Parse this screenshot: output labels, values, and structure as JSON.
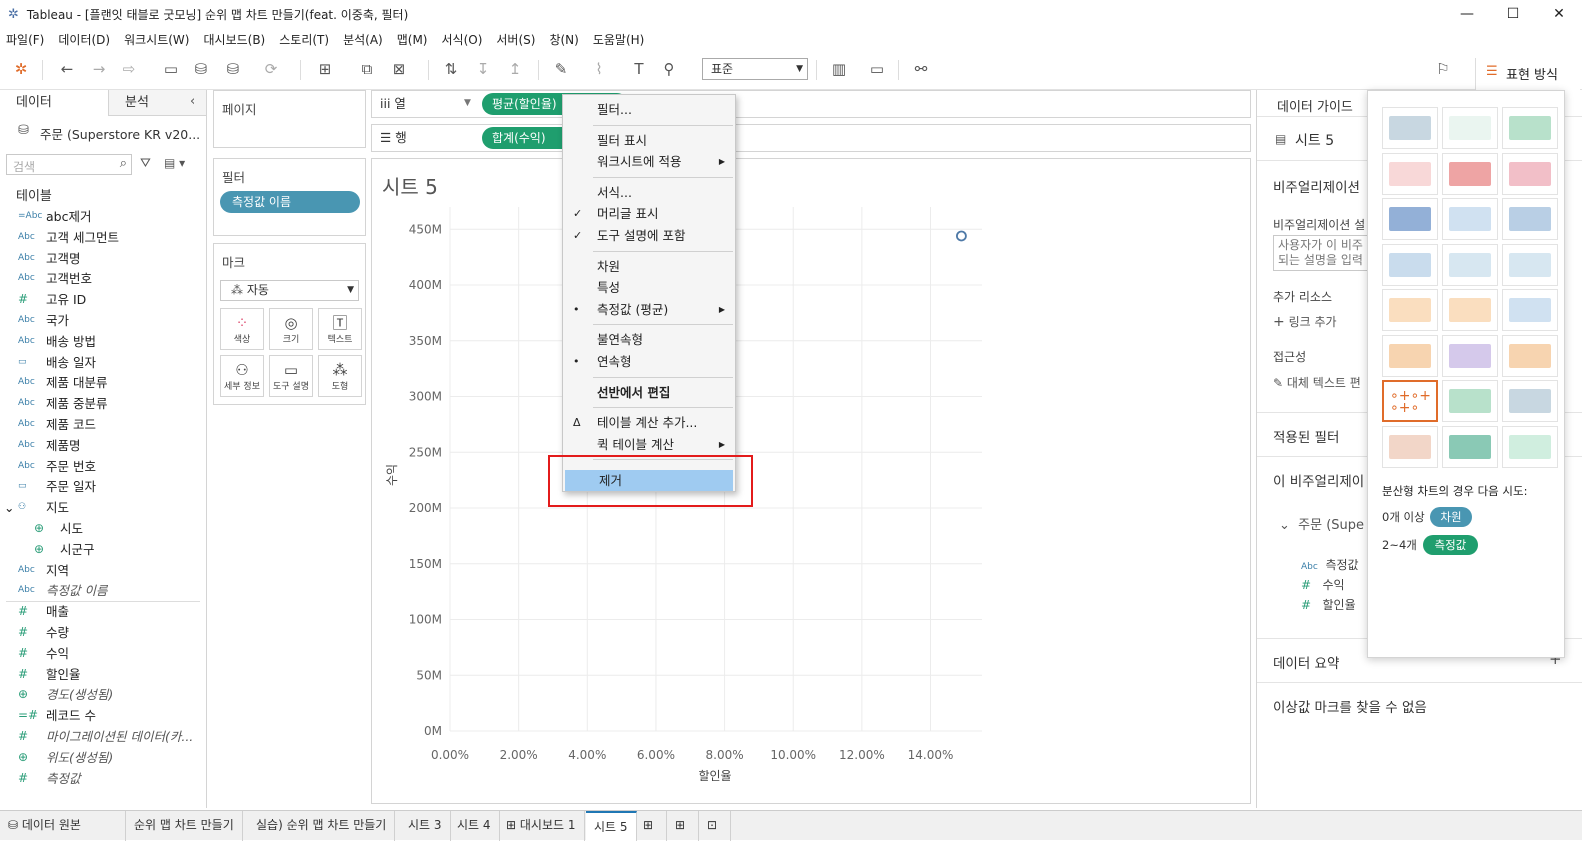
{
  "window": {
    "title": "Tableau - [플랜잇 태블로 굿모닝] 순위 맵 차트 만들기(feat. 이중축, 필터)"
  },
  "menu": [
    "파일(F)",
    "데이터(D)",
    "워크시트(W)",
    "대시보드(B)",
    "스토리(T)",
    "분석(A)",
    "맵(M)",
    "서식(O)",
    "서버(S)",
    "창(N)",
    "도움말(H)"
  ],
  "toolbar": {
    "fit_select": "표준",
    "show_me_label": "표현 방식"
  },
  "left": {
    "tab_data": "데이터",
    "tab_analysis": "분석",
    "datasource": "주문 (Superstore KR v20...",
    "search_placeholder": "검색",
    "tables_header": "테이블",
    "fields": [
      {
        "icon": "=Abc",
        "name": "abc제거"
      },
      {
        "icon": "Abc",
        "name": "고객 세그먼트"
      },
      {
        "icon": "Abc",
        "name": "고객명"
      },
      {
        "icon": "Abc",
        "name": "고객번호"
      },
      {
        "icon": "#",
        "name": "고유 ID"
      },
      {
        "icon": "Abc",
        "name": "국가"
      },
      {
        "icon": "Abc",
        "name": "배송 방법"
      },
      {
        "icon": "date",
        "name": "배송 일자"
      },
      {
        "icon": "Abc",
        "name": "제품 대분류"
      },
      {
        "icon": "Abc",
        "name": "제품 중분류"
      },
      {
        "icon": "Abc",
        "name": "제품 코드"
      },
      {
        "icon": "Abc",
        "name": "제품명"
      },
      {
        "icon": "Abc",
        "name": "주문 번호"
      },
      {
        "icon": "date",
        "name": "주문 일자"
      },
      {
        "icon": "hier",
        "name": "지도"
      },
      {
        "icon": "globe",
        "name": "시도"
      },
      {
        "icon": "globe",
        "name": "시군구"
      },
      {
        "icon": "Abc",
        "name": "지역"
      },
      {
        "icon": "Abc",
        "name": "측정값 이름"
      },
      {
        "icon": "#",
        "name": "매출"
      },
      {
        "icon": "#",
        "name": "수량"
      },
      {
        "icon": "#",
        "name": "수익"
      },
      {
        "icon": "#",
        "name": "할인율"
      },
      {
        "icon": "globe",
        "name": "경도(생성됨)"
      },
      {
        "icon": "=#",
        "name": "레코드 수"
      },
      {
        "icon": "#",
        "name": "마이그레이션된 데이터(카..."
      },
      {
        "icon": "globe",
        "name": "위도(생성됨)"
      },
      {
        "icon": "#",
        "name": "측정값"
      }
    ]
  },
  "cards": {
    "pages": "페이지",
    "filters": "필터",
    "filter_pill": "측정값 이름",
    "marks": "마크",
    "mark_type": "자동",
    "mark_buttons": [
      "색상",
      "크기",
      "텍스트",
      "세부 정보",
      "도구 설명",
      "도형"
    ]
  },
  "shelves": {
    "columns_label": "열",
    "rows_label": "행",
    "columns_pill": "평균(할인율)",
    "rows_pill": "합계(수익)"
  },
  "view": {
    "sheet_title": "시트 5"
  },
  "context_menu": {
    "items": [
      {
        "label": "필터...",
        "check": "",
        "sub": ""
      },
      {
        "label": "필터 표시",
        "check": "",
        "sub": ""
      },
      {
        "label": "워크시트에 적용",
        "check": "",
        "sub": "▶"
      },
      {
        "label": "서식...",
        "check": "",
        "sub": ""
      },
      {
        "label": "머리글 표시",
        "check": "✓",
        "sub": ""
      },
      {
        "label": "도구 설명에 포함",
        "check": "✓",
        "sub": ""
      },
      {
        "label": "차원",
        "check": "",
        "sub": ""
      },
      {
        "label": "특성",
        "check": "",
        "sub": ""
      },
      {
        "label": "측정값 (평균)",
        "check": "•",
        "sub": "▶"
      },
      {
        "label": "불연속형",
        "check": "",
        "sub": ""
      },
      {
        "label": "연속형",
        "check": "•",
        "sub": ""
      },
      {
        "label": "선반에서 편집",
        "check": "",
        "sub": ""
      },
      {
        "label": "테이블 계산 추가...",
        "check": "Δ",
        "sub": ""
      },
      {
        "label": "퀵 테이블 계산",
        "check": "",
        "sub": "▶"
      },
      {
        "label": "제거",
        "check": "",
        "sub": ""
      }
    ]
  },
  "chart_data": {
    "type": "scatter",
    "title": "",
    "xlabel": "할인율",
    "ylabel": "수익",
    "x_ticks": [
      "0.00%",
      "2.00%",
      "4.00%",
      "6.00%",
      "8.00%",
      "10.00%",
      "12.00%",
      "14.00%"
    ],
    "y_ticks": [
      "0M",
      "50M",
      "100M",
      "150M",
      "200M",
      "250M",
      "300M",
      "350M",
      "400M",
      "450M"
    ],
    "xlim": [
      0,
      0.155
    ],
    "ylim": [
      0,
      470000000
    ],
    "points": [
      {
        "x": 0.149,
        "y": 444000000
      }
    ],
    "grid": true
  },
  "right": {
    "data_guide": "데이터 가이드",
    "sheet": "시트 5",
    "viz_section": "비주얼리제이션",
    "viz_desc_label": "비주얼리제이션 설",
    "viz_desc_placeholder_1": "사용자가 이 비주",
    "viz_desc_placeholder_2": "되는 설명을 입력",
    "extra_resources": "추가 리소스",
    "add_link": "링크 추가",
    "accessibility": "접근성",
    "alt_text": "대체 텍스트 편",
    "applied_filters": "적용된 필터",
    "this_viz": "이 비주얼리제이",
    "source": "주문 (Supe",
    "fields": [
      "측정값",
      "수익",
      "할인율"
    ],
    "data_summary": "데이터 요약",
    "outliers": "이상값 마크를 찾을 수 없음"
  },
  "showme": {
    "hint": "분산형 차트의 경우 다음 시도:",
    "dim_count": "0개 이상",
    "dim_label": "차원",
    "meas_count": "2~4개",
    "meas_label": "측정값"
  },
  "tabs": [
    "데이터 원본",
    "순위 맵 차트 만들기",
    "실습) 순위 맵 차트 만들기",
    "시트 3",
    "시트 4",
    "대시보드 1",
    "시트 5"
  ],
  "colors": {
    "pill_green": "#1f9e6e",
    "pill_blue": "#4996b2",
    "highlight": "#9fcbf1",
    "red_box": "#e31b1b"
  }
}
